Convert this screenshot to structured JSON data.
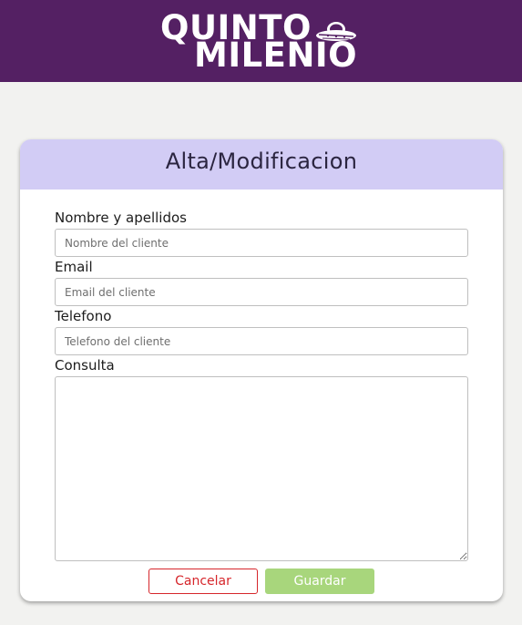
{
  "brand": {
    "line1": "QUINTO",
    "line2": "MILENIO",
    "colors": {
      "topbar": "#542063",
      "card_header": "#d2ccf5",
      "cancel": "#d6262b",
      "save": "#a8d67c"
    },
    "icon": "ufo-icon"
  },
  "form": {
    "title": "Alta/Modificacion",
    "fields": [
      {
        "label": "Nombre y apellidos",
        "placeholder": "Nombre del cliente",
        "value": ""
      },
      {
        "label": "Email",
        "placeholder": "Email del cliente",
        "value": ""
      },
      {
        "label": "Telefono",
        "placeholder": "Telefono del cliente",
        "value": ""
      },
      {
        "label": "Consulta",
        "placeholder": "",
        "value": ""
      }
    ],
    "buttons": {
      "cancel": "Cancelar",
      "save": "Guardar"
    }
  }
}
